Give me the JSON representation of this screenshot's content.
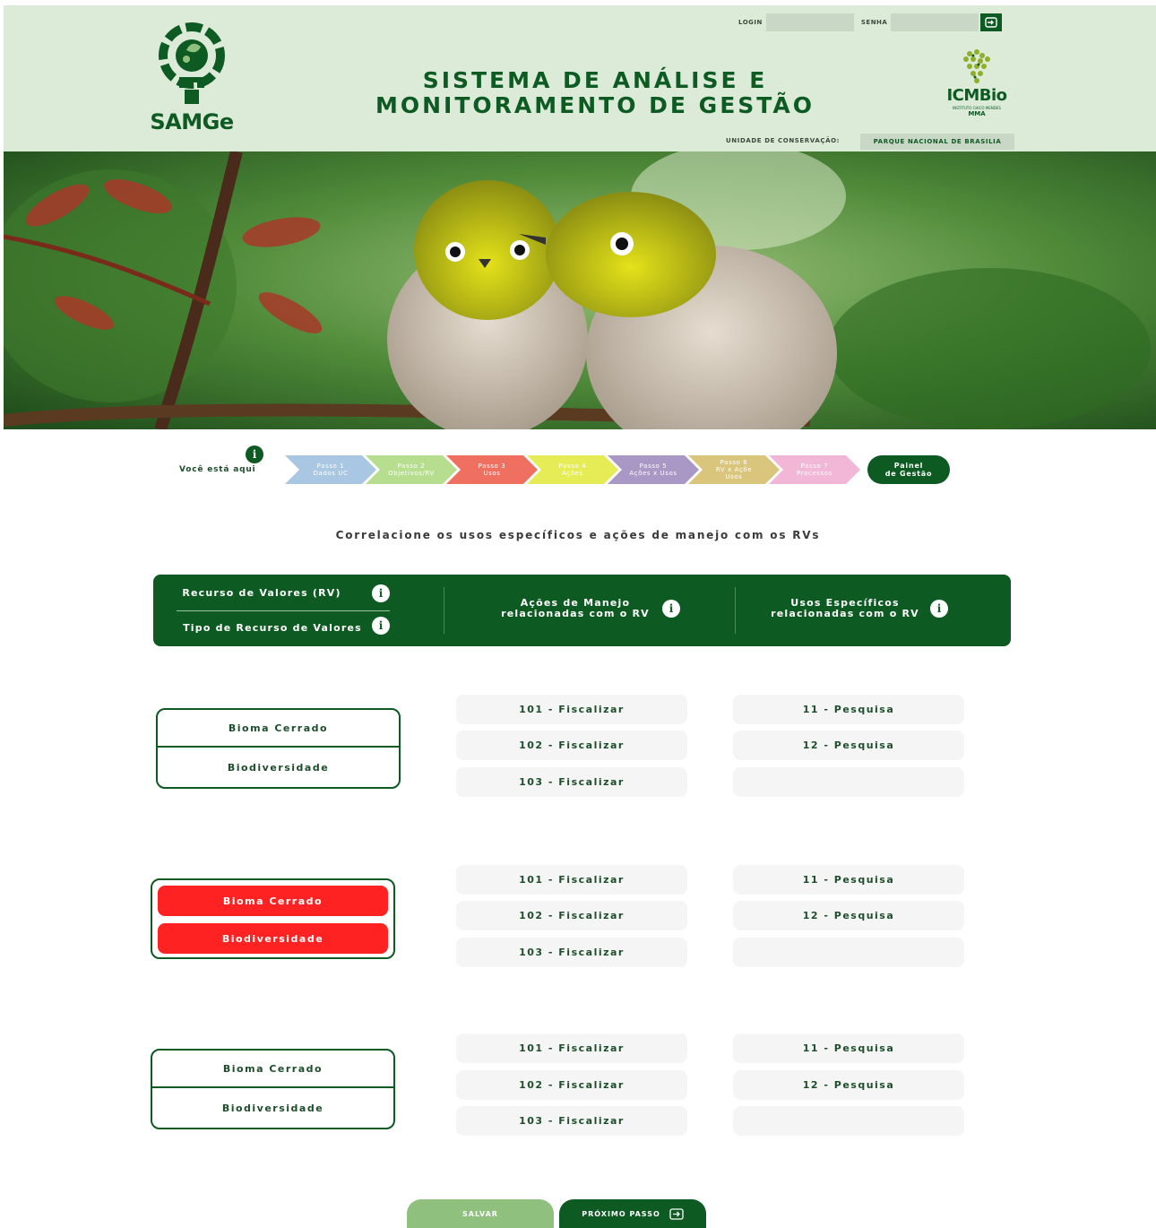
{
  "header": {
    "logo_text": "SAMGe",
    "title_line1": "SISTEMA DE ANÁLISE E",
    "title_line2": "MONITORAMENTO DE GESTÃO",
    "login_label": "LOGIN",
    "senha_label": "SENHA",
    "login_value": "",
    "senha_value": "",
    "partner_logo": "ICMBio",
    "partner_sub": "INSTITUTO CHICO MENDES",
    "partner_mma": "MMA",
    "uc_label": "UNIDADE DE CONSERVAÇÃO:",
    "uc_value": "PARQUE NACIONAL DE BRASILIA"
  },
  "steps": {
    "you_are_here": "Você está aqui",
    "items": [
      {
        "l1": "Passo 1",
        "l2": "Dados UC",
        "l3": "",
        "color": "#a9c7e2"
      },
      {
        "l1": "Passo 2",
        "l2": "Objetivos/RV",
        "l3": "",
        "color": "#b7dd8f"
      },
      {
        "l1": "Passo 3",
        "l2": "Usos",
        "l3": "",
        "color": "#ef6f60"
      },
      {
        "l1": "Passo 4",
        "l2": "Ações",
        "l3": "",
        "color": "#e6ec55"
      },
      {
        "l1": "Passo 5",
        "l2": "Ações x Usos",
        "l3": "",
        "color": "#a997c6"
      },
      {
        "l1": "Passo 6",
        "l2": "RV x Açõe",
        "l3": "Usos",
        "color": "#d9c67c"
      },
      {
        "l1": "Passo 7",
        "l2": "Processos",
        "l3": "",
        "color": "#f2b6d7"
      }
    ],
    "panel_l1": "Painel",
    "panel_l2": "de Gestão"
  },
  "subtitle": "Correlacione os usos específicos e ações de manejo com os RVs",
  "table_header": {
    "rv": "Recurso de Valores (RV)",
    "tipo": "Tipo de Recurso de Valores",
    "acoes_l1": "Ações de Manejo",
    "acoes_l2": "relacionadas com o RV",
    "usos_l1": "Usos Específicos",
    "usos_l2": "relacionadas com o RV"
  },
  "rows": [
    {
      "rv": "Bioma Cerrado",
      "tipo": "Biodiversidade",
      "acoes": [
        "101 - Fiscalizar",
        "102 - Fiscalizar",
        "103 - Fiscalizar"
      ],
      "usos": [
        "11 - Pesquisa",
        "12 - Pesquisa",
        ""
      ]
    },
    {
      "rv": "Bioma Cerrado",
      "tipo": "Biodiversidade",
      "acoes": [
        "101 - Fiscalizar",
        "102 - Fiscalizar",
        "103 - Fiscalizar"
      ],
      "usos": [
        "11 - Pesquisa",
        "12 - Pesquisa",
        ""
      ]
    },
    {
      "rv": "Bioma Cerrado",
      "tipo": "Biodiversidade",
      "acoes": [
        "101 - Fiscalizar",
        "102 - Fiscalizar",
        "103 - Fiscalizar"
      ],
      "usos": [
        "11 - Pesquisa",
        "12 - Pesquisa",
        ""
      ]
    }
  ],
  "buttons": {
    "save": "SALVAR",
    "next": "PRÓXIMO PASSO"
  },
  "colors": {
    "brand_green": "#0d5a22",
    "header_bg": "#dcebd8",
    "highlight_red": "#ff2222",
    "save_green": "#8fc07e"
  }
}
